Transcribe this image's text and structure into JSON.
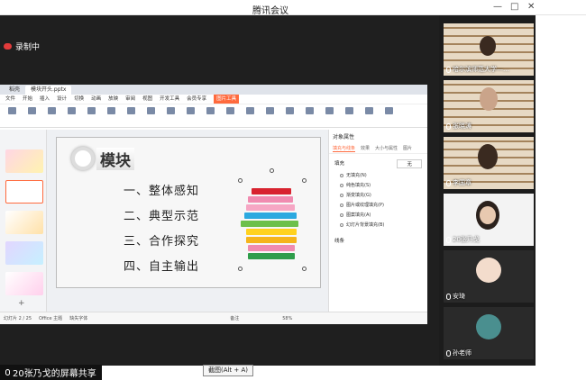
{
  "window": {
    "title": "腾讯会议"
  },
  "recording": {
    "label": "录制中"
  },
  "wps": {
    "tabs": [
      "稻壳",
      "模块开头.pptx"
    ],
    "menus": [
      "文件",
      "开始",
      "插入",
      "设计",
      "切换",
      "动画",
      "放映",
      "审阅",
      "视图",
      "开发工具",
      "会员专享",
      "图片工具"
    ],
    "slide": {
      "title": "模块",
      "items": [
        "一、整体感知",
        "二、典型示范",
        "三、合作探究",
        "四、自主输出"
      ]
    },
    "panel": {
      "header": "对象属性",
      "tabs": [
        "填充与线条",
        "效果",
        "大小与属性",
        "图片"
      ],
      "section1": "填充",
      "section2": "线条",
      "options": [
        "无填充(N)",
        "纯色填充(S)",
        "渐变填充(G)",
        "图片或纹理填充(P)",
        "图案填充(A)",
        "幻灯片背景填充(B)"
      ],
      "fill_value": "无"
    },
    "status": {
      "page": "幻灯片 2 / 25",
      "theme": "Office 主题",
      "font": "缺失字体",
      "notes": "备注",
      "zoom": "58%"
    }
  },
  "participants": [
    {
      "name": "哈尔滨师范大学—…"
    },
    {
      "name": "张晓涛"
    },
    {
      "name": "李国章"
    },
    {
      "name": "20张乃戈"
    },
    {
      "name": "安琦"
    },
    {
      "name": "孙老师"
    }
  ],
  "share": {
    "label": "20张乃戈的屏幕共享"
  },
  "tooltip": {
    "label": "截图(Alt + A)"
  },
  "colors": {
    "accent": "#ff6a3d",
    "stage": "#1f1f1f"
  }
}
